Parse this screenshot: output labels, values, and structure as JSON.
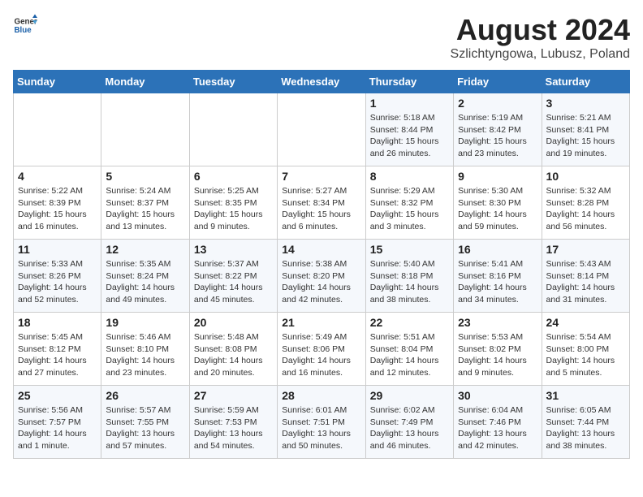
{
  "header": {
    "logo_general": "General",
    "logo_blue": "Blue",
    "month_year": "August 2024",
    "location": "Szlichtyngowa, Lubusz, Poland"
  },
  "weekdays": [
    "Sunday",
    "Monday",
    "Tuesday",
    "Wednesday",
    "Thursday",
    "Friday",
    "Saturday"
  ],
  "weeks": [
    [
      {
        "day": "",
        "info": ""
      },
      {
        "day": "",
        "info": ""
      },
      {
        "day": "",
        "info": ""
      },
      {
        "day": "",
        "info": ""
      },
      {
        "day": "1",
        "info": "Sunrise: 5:18 AM\nSunset: 8:44 PM\nDaylight: 15 hours\nand 26 minutes."
      },
      {
        "day": "2",
        "info": "Sunrise: 5:19 AM\nSunset: 8:42 PM\nDaylight: 15 hours\nand 23 minutes."
      },
      {
        "day": "3",
        "info": "Sunrise: 5:21 AM\nSunset: 8:41 PM\nDaylight: 15 hours\nand 19 minutes."
      }
    ],
    [
      {
        "day": "4",
        "info": "Sunrise: 5:22 AM\nSunset: 8:39 PM\nDaylight: 15 hours\nand 16 minutes."
      },
      {
        "day": "5",
        "info": "Sunrise: 5:24 AM\nSunset: 8:37 PM\nDaylight: 15 hours\nand 13 minutes."
      },
      {
        "day": "6",
        "info": "Sunrise: 5:25 AM\nSunset: 8:35 PM\nDaylight: 15 hours\nand 9 minutes."
      },
      {
        "day": "7",
        "info": "Sunrise: 5:27 AM\nSunset: 8:34 PM\nDaylight: 15 hours\nand 6 minutes."
      },
      {
        "day": "8",
        "info": "Sunrise: 5:29 AM\nSunset: 8:32 PM\nDaylight: 15 hours\nand 3 minutes."
      },
      {
        "day": "9",
        "info": "Sunrise: 5:30 AM\nSunset: 8:30 PM\nDaylight: 14 hours\nand 59 minutes."
      },
      {
        "day": "10",
        "info": "Sunrise: 5:32 AM\nSunset: 8:28 PM\nDaylight: 14 hours\nand 56 minutes."
      }
    ],
    [
      {
        "day": "11",
        "info": "Sunrise: 5:33 AM\nSunset: 8:26 PM\nDaylight: 14 hours\nand 52 minutes."
      },
      {
        "day": "12",
        "info": "Sunrise: 5:35 AM\nSunset: 8:24 PM\nDaylight: 14 hours\nand 49 minutes."
      },
      {
        "day": "13",
        "info": "Sunrise: 5:37 AM\nSunset: 8:22 PM\nDaylight: 14 hours\nand 45 minutes."
      },
      {
        "day": "14",
        "info": "Sunrise: 5:38 AM\nSunset: 8:20 PM\nDaylight: 14 hours\nand 42 minutes."
      },
      {
        "day": "15",
        "info": "Sunrise: 5:40 AM\nSunset: 8:18 PM\nDaylight: 14 hours\nand 38 minutes."
      },
      {
        "day": "16",
        "info": "Sunrise: 5:41 AM\nSunset: 8:16 PM\nDaylight: 14 hours\nand 34 minutes."
      },
      {
        "day": "17",
        "info": "Sunrise: 5:43 AM\nSunset: 8:14 PM\nDaylight: 14 hours\nand 31 minutes."
      }
    ],
    [
      {
        "day": "18",
        "info": "Sunrise: 5:45 AM\nSunset: 8:12 PM\nDaylight: 14 hours\nand 27 minutes."
      },
      {
        "day": "19",
        "info": "Sunrise: 5:46 AM\nSunset: 8:10 PM\nDaylight: 14 hours\nand 23 minutes."
      },
      {
        "day": "20",
        "info": "Sunrise: 5:48 AM\nSunset: 8:08 PM\nDaylight: 14 hours\nand 20 minutes."
      },
      {
        "day": "21",
        "info": "Sunrise: 5:49 AM\nSunset: 8:06 PM\nDaylight: 14 hours\nand 16 minutes."
      },
      {
        "day": "22",
        "info": "Sunrise: 5:51 AM\nSunset: 8:04 PM\nDaylight: 14 hours\nand 12 minutes."
      },
      {
        "day": "23",
        "info": "Sunrise: 5:53 AM\nSunset: 8:02 PM\nDaylight: 14 hours\nand 9 minutes."
      },
      {
        "day": "24",
        "info": "Sunrise: 5:54 AM\nSunset: 8:00 PM\nDaylight: 14 hours\nand 5 minutes."
      }
    ],
    [
      {
        "day": "25",
        "info": "Sunrise: 5:56 AM\nSunset: 7:57 PM\nDaylight: 14 hours\nand 1 minute."
      },
      {
        "day": "26",
        "info": "Sunrise: 5:57 AM\nSunset: 7:55 PM\nDaylight: 13 hours\nand 57 minutes."
      },
      {
        "day": "27",
        "info": "Sunrise: 5:59 AM\nSunset: 7:53 PM\nDaylight: 13 hours\nand 54 minutes."
      },
      {
        "day": "28",
        "info": "Sunrise: 6:01 AM\nSunset: 7:51 PM\nDaylight: 13 hours\nand 50 minutes."
      },
      {
        "day": "29",
        "info": "Sunrise: 6:02 AM\nSunset: 7:49 PM\nDaylight: 13 hours\nand 46 minutes."
      },
      {
        "day": "30",
        "info": "Sunrise: 6:04 AM\nSunset: 7:46 PM\nDaylight: 13 hours\nand 42 minutes."
      },
      {
        "day": "31",
        "info": "Sunrise: 6:05 AM\nSunset: 7:44 PM\nDaylight: 13 hours\nand 38 minutes."
      }
    ]
  ]
}
